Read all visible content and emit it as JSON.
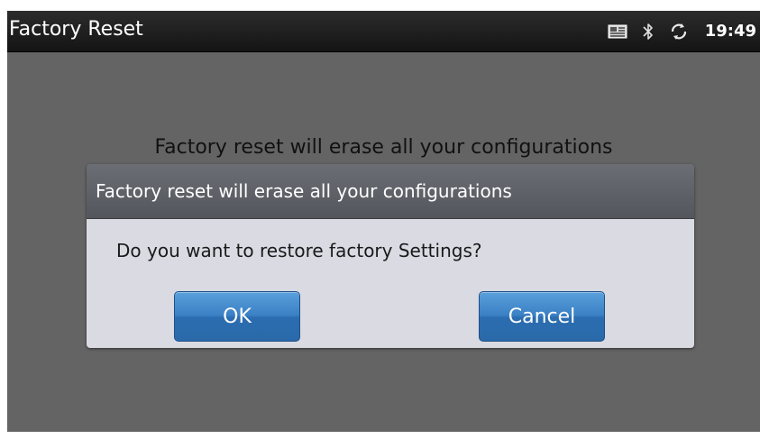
{
  "app_bar": {
    "title": "Factory Reset",
    "status": {
      "icons": [
        "newsletter-icon",
        "bluetooth-icon",
        "sync-icon"
      ],
      "time": "19:49"
    }
  },
  "background": {
    "message": "Factory reset will erase all your configurations"
  },
  "dialog": {
    "title": "Factory reset will erase all your configurations",
    "message": "Do you want to restore factory Settings?",
    "ok_label": "OK",
    "cancel_label": "Cancel"
  },
  "colors": {
    "screen_bg": "#646464",
    "dialog_body": "#d9dae2",
    "button_blue": "#3a80c4"
  }
}
